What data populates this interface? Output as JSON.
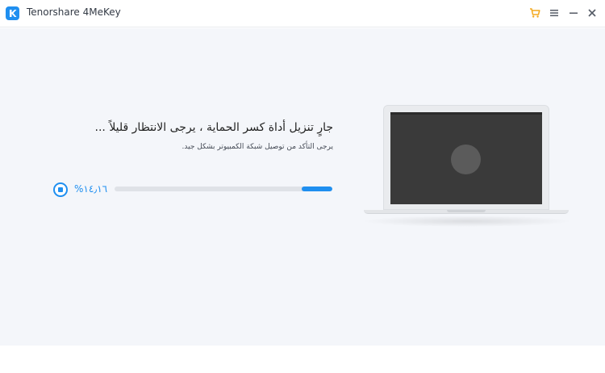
{
  "titlebar": {
    "app_name": "Tenorshare 4MeKey",
    "icons": [
      "app-logo-icon",
      "cart-icon",
      "menu-icon",
      "minimize-icon",
      "close-icon"
    ]
  },
  "status": {
    "title": "جارٍ تنزيل أداة كسر الحماية ، يرجى الانتظار قليلاً ...",
    "subtitle": "يرجى التأكد من توصيل شبكة الكمبيوتر بشكل جيد."
  },
  "progress": {
    "text": "%١٤٫١٦",
    "fraction": 0.1416
  },
  "colors": {
    "accent": "#1f8ff0",
    "background": "#f4f6fa",
    "cart_icon": "#f3a81d",
    "track": "#dfe2e7",
    "screen": "#3a3a3a"
  }
}
